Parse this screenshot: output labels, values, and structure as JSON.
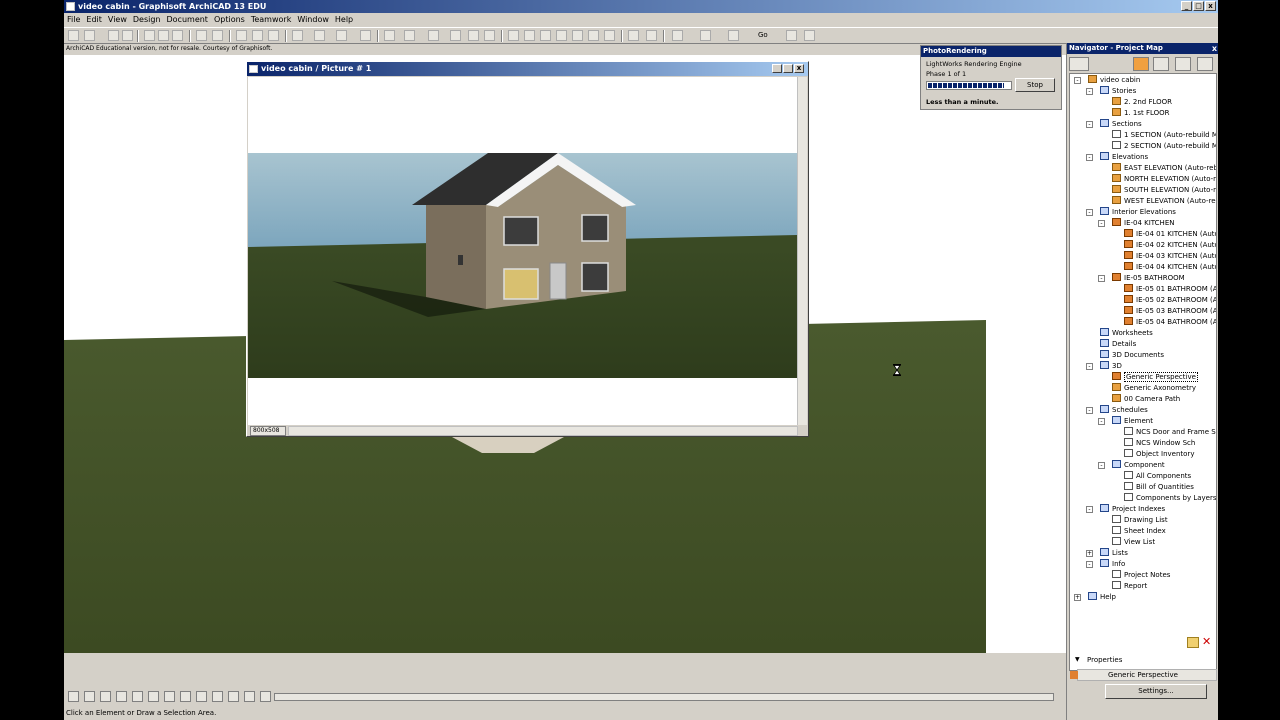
{
  "window": {
    "title": "video cabin - Graphisoft ArchiCAD 13 EDU",
    "minimize": "_",
    "maximize": "□",
    "close": "x"
  },
  "menu": [
    "File",
    "Edit",
    "View",
    "Design",
    "Document",
    "Options",
    "Teamwork",
    "Window",
    "Help"
  ],
  "edu_note": "ArchiCAD Educational version, not for resale. Courtesy of Graphisoft.",
  "toolbar": {
    "go_label": "Go"
  },
  "picture_window": {
    "title": "video cabin / Picture # 1",
    "size_label": "800x508"
  },
  "photo_rendering": {
    "title": "PhotoRendering",
    "engine": "LightWorks Rendering Engine",
    "phase": "Phase 1 of 1",
    "progress": 0.93,
    "stop_label": "Stop",
    "time_left": "Less than a minute."
  },
  "navigator": {
    "title": "Navigator - Project Map",
    "close": "x",
    "tree": [
      {
        "label": "video cabin",
        "level": 0,
        "icon": "house",
        "exp": "-"
      },
      {
        "label": "Stories",
        "level": 1,
        "icon": "blue",
        "exp": "-"
      },
      {
        "label": "2. 2nd FLOOR",
        "level": 2,
        "icon": "story",
        "exp": ""
      },
      {
        "label": "1. 1st FLOOR",
        "level": 2,
        "icon": "story",
        "exp": ""
      },
      {
        "label": "Sections",
        "level": 1,
        "icon": "blue",
        "exp": "-"
      },
      {
        "label": "1 SECTION (Auto-rebuild Mc",
        "level": 2,
        "icon": "doc",
        "exp": ""
      },
      {
        "label": "2 SECTION (Auto-rebuild Mc",
        "level": 2,
        "icon": "doc",
        "exp": ""
      },
      {
        "label": "Elevations",
        "level": 1,
        "icon": "blue",
        "exp": "-"
      },
      {
        "label": "EAST ELEVATION (Auto-rebu",
        "level": 2,
        "icon": "house",
        "exp": ""
      },
      {
        "label": "NORTH ELEVATION (Auto-re",
        "level": 2,
        "icon": "house",
        "exp": ""
      },
      {
        "label": "SOUTH ELEVATION (Auto-re",
        "level": 2,
        "icon": "house",
        "exp": ""
      },
      {
        "label": "WEST ELEVATION (Auto-reb",
        "level": 2,
        "icon": "house",
        "exp": ""
      },
      {
        "label": "Interior Elevations",
        "level": 1,
        "icon": "blue",
        "exp": "-"
      },
      {
        "label": "IE-04  KITCHEN",
        "level": 2,
        "icon": "ie",
        "exp": "-"
      },
      {
        "label": "IE-04 01 KITCHEN (Auto",
        "level": 3,
        "icon": "ie",
        "exp": ""
      },
      {
        "label": "IE-04 02 KITCHEN (Auto",
        "level": 3,
        "icon": "ie",
        "exp": ""
      },
      {
        "label": "IE-04 03 KITCHEN (Auto",
        "level": 3,
        "icon": "ie",
        "exp": ""
      },
      {
        "label": "IE-04 04 KITCHEN (Auto",
        "level": 3,
        "icon": "ie",
        "exp": ""
      },
      {
        "label": "IE-05  BATHROOM",
        "level": 2,
        "icon": "ie",
        "exp": "-"
      },
      {
        "label": "IE-05 01 BATHROOM (A",
        "level": 3,
        "icon": "ie",
        "exp": ""
      },
      {
        "label": "IE-05 02 BATHROOM (A",
        "level": 3,
        "icon": "ie",
        "exp": ""
      },
      {
        "label": "IE-05 03 BATHROOM (A",
        "level": 3,
        "icon": "ie",
        "exp": ""
      },
      {
        "label": "IE-05 04 BATHROOM (A",
        "level": 3,
        "icon": "ie",
        "exp": ""
      },
      {
        "label": "Worksheets",
        "level": 1,
        "icon": "blue",
        "exp": ""
      },
      {
        "label": "Details",
        "level": 1,
        "icon": "blue",
        "exp": ""
      },
      {
        "label": "3D Documents",
        "level": 1,
        "icon": "blue",
        "exp": ""
      },
      {
        "label": "3D",
        "level": 1,
        "icon": "blue",
        "exp": "-"
      },
      {
        "label": "Generic Perspective",
        "level": 2,
        "icon": "ie",
        "exp": "",
        "selected": true
      },
      {
        "label": "Generic Axonometry",
        "level": 2,
        "icon": "story",
        "exp": ""
      },
      {
        "label": "00 Camera Path",
        "level": 2,
        "icon": "story",
        "exp": ""
      },
      {
        "label": "Schedules",
        "level": 1,
        "icon": "blue",
        "exp": "-"
      },
      {
        "label": "Element",
        "level": 2,
        "icon": "blue",
        "exp": "-"
      },
      {
        "label": "NCS Door and Frame Sc",
        "level": 3,
        "icon": "doc",
        "exp": ""
      },
      {
        "label": "NCS Window Sch",
        "level": 3,
        "icon": "doc",
        "exp": ""
      },
      {
        "label": "Object Inventory",
        "level": 3,
        "icon": "doc",
        "exp": ""
      },
      {
        "label": "Component",
        "level": 2,
        "icon": "blue",
        "exp": "-"
      },
      {
        "label": "All Components",
        "level": 3,
        "icon": "doc",
        "exp": ""
      },
      {
        "label": "Bill of Quantities",
        "level": 3,
        "icon": "doc",
        "exp": ""
      },
      {
        "label": "Components by Layers",
        "level": 3,
        "icon": "doc",
        "exp": ""
      },
      {
        "label": "Project Indexes",
        "level": 1,
        "icon": "blue",
        "exp": "-"
      },
      {
        "label": "Drawing List",
        "level": 2,
        "icon": "doc",
        "exp": ""
      },
      {
        "label": "Sheet Index",
        "level": 2,
        "icon": "doc",
        "exp": ""
      },
      {
        "label": "View List",
        "level": 2,
        "icon": "doc",
        "exp": ""
      },
      {
        "label": "Lists",
        "level": 1,
        "icon": "blue",
        "exp": "+"
      },
      {
        "label": "Info",
        "level": 1,
        "icon": "blue",
        "exp": "-"
      },
      {
        "label": "Project Notes",
        "level": 2,
        "icon": "doc",
        "exp": ""
      },
      {
        "label": "Report",
        "level": 2,
        "icon": "doc",
        "exp": ""
      },
      {
        "label": "Help",
        "level": 0,
        "icon": "blue",
        "exp": "+"
      }
    ],
    "properties_label": "Properties",
    "properties_value": "Generic Perspective",
    "settings_label": "Settings..."
  },
  "status": "Click an Element or Draw a Selection Area."
}
